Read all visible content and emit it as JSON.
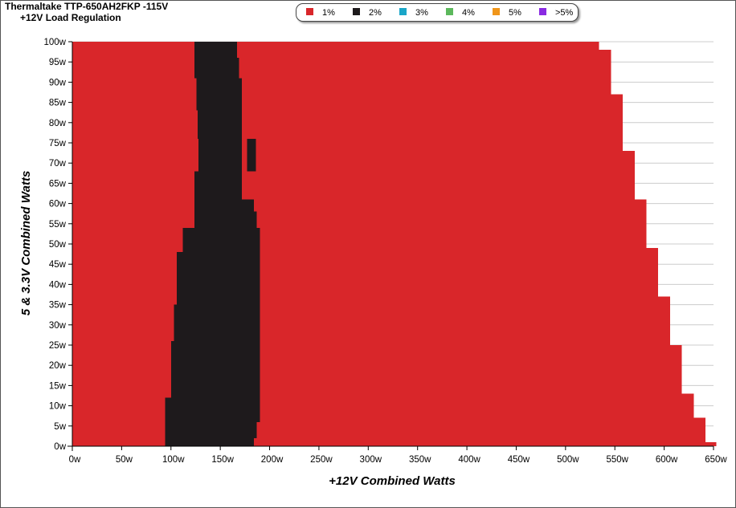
{
  "chart_data": {
    "type": "heatmap",
    "title": "Thermaltake TTP-650AH2FKP -115V",
    "subtitle": "+12V Load Regulation",
    "xlabel": "+12V Combined Watts",
    "ylabel": "5 & 3.3V Combined Watts",
    "xlim": [
      0,
      650
    ],
    "ylim": [
      0,
      100
    ],
    "x_ticks": [
      0,
      50,
      100,
      150,
      200,
      250,
      300,
      350,
      400,
      450,
      500,
      550,
      600,
      650
    ],
    "x_tick_labels": [
      "0w",
      "50w",
      "100w",
      "150w",
      "200w",
      "250w",
      "300w",
      "350w",
      "400w",
      "450w",
      "500w",
      "550w",
      "600w",
      "650w"
    ],
    "y_ticks": [
      0,
      5,
      10,
      15,
      20,
      25,
      30,
      35,
      40,
      45,
      50,
      55,
      60,
      65,
      70,
      75,
      80,
      85,
      90,
      95,
      100
    ],
    "y_tick_labels": [
      "0w",
      "5w",
      "10w",
      "15w",
      "20w",
      "25w",
      "30w",
      "35w",
      "40w",
      "45w",
      "50w",
      "55w",
      "60w",
      "65w",
      "70w",
      "75w",
      "80w",
      "85w",
      "90w",
      "95w",
      "100w"
    ],
    "grid": true,
    "legend_position": "top-center",
    "legend": [
      {
        "label": "1%",
        "color": "#d9262a"
      },
      {
        "label": "2%",
        "color": "#1e1a1c"
      },
      {
        "label": "3%",
        "color": "#1aa6c8"
      },
      {
        "label": "4%",
        "color": "#5cb85c"
      },
      {
        "label": "5%",
        "color": "#f0961a"
      },
      {
        "label": ">5%",
        "color": "#8a2be2"
      }
    ],
    "regions": [
      {
        "y0": 0,
        "y1": 1,
        "deviation": "1%",
        "x0": 0,
        "x1": 653
      },
      {
        "y0": 1,
        "y1": 7,
        "deviation": "1%",
        "x0": 0,
        "x1": 642
      },
      {
        "y0": 7,
        "y1": 13,
        "deviation": "1%",
        "x0": 0,
        "x1": 630
      },
      {
        "y0": 13,
        "y1": 25,
        "deviation": "1%",
        "x0": 0,
        "x1": 618
      },
      {
        "y0": 25,
        "y1": 37,
        "deviation": "1%",
        "x0": 0,
        "x1": 606
      },
      {
        "y0": 37,
        "y1": 49,
        "deviation": "1%",
        "x0": 0,
        "x1": 594
      },
      {
        "y0": 49,
        "y1": 61,
        "deviation": "1%",
        "x0": 0,
        "x1": 582
      },
      {
        "y0": 61,
        "y1": 73,
        "deviation": "1%",
        "x0": 0,
        "x1": 570
      },
      {
        "y0": 73,
        "y1": 87,
        "deviation": "1%",
        "x0": 0,
        "x1": 558
      },
      {
        "y0": 87,
        "y1": 98,
        "deviation": "1%",
        "x0": 0,
        "x1": 546
      },
      {
        "y0": 98,
        "y1": 100,
        "deviation": "1%",
        "x0": 0,
        "x1": 534
      }
    ],
    "boundary_2pct": [
      {
        "y0": 0,
        "y1": 2,
        "x0": 94,
        "x1": 184
      },
      {
        "y0": 2,
        "y1": 6,
        "x0": 94,
        "x1": 187
      },
      {
        "y0": 6,
        "y1": 12,
        "x0": 94,
        "x1": 190
      },
      {
        "y0": 12,
        "y1": 26,
        "x0": 100,
        "x1": 190
      },
      {
        "y0": 26,
        "y1": 35,
        "x0": 103,
        "x1": 190
      },
      {
        "y0": 35,
        "y1": 48,
        "x0": 106,
        "x1": 190
      },
      {
        "y0": 48,
        "y1": 54,
        "x0": 112,
        "x1": 190
      },
      {
        "y0": 54,
        "y1": 58,
        "x0": 124,
        "x1": 187
      },
      {
        "y0": 58,
        "y1": 61,
        "x0": 124,
        "x1": 184
      },
      {
        "y0": 61,
        "y1": 68,
        "x0": 124,
        "x1": 172
      },
      {
        "y0": 68,
        "y1": 76,
        "x0": 128,
        "x1": 172
      },
      {
        "y0": 76,
        "y1": 83,
        "x0": 127,
        "x1": 172
      },
      {
        "y0": 83,
        "y1": 91,
        "x0": 126,
        "x1": 172
      },
      {
        "y0": 91,
        "y1": 96,
        "x0": 124,
        "x1": 169
      },
      {
        "y0": 96,
        "y1": 100,
        "x0": 124,
        "x1": 167
      }
    ],
    "island_2pct": [
      {
        "y0": 68,
        "y1": 76,
        "x0": 177,
        "x1": 186
      }
    ]
  }
}
